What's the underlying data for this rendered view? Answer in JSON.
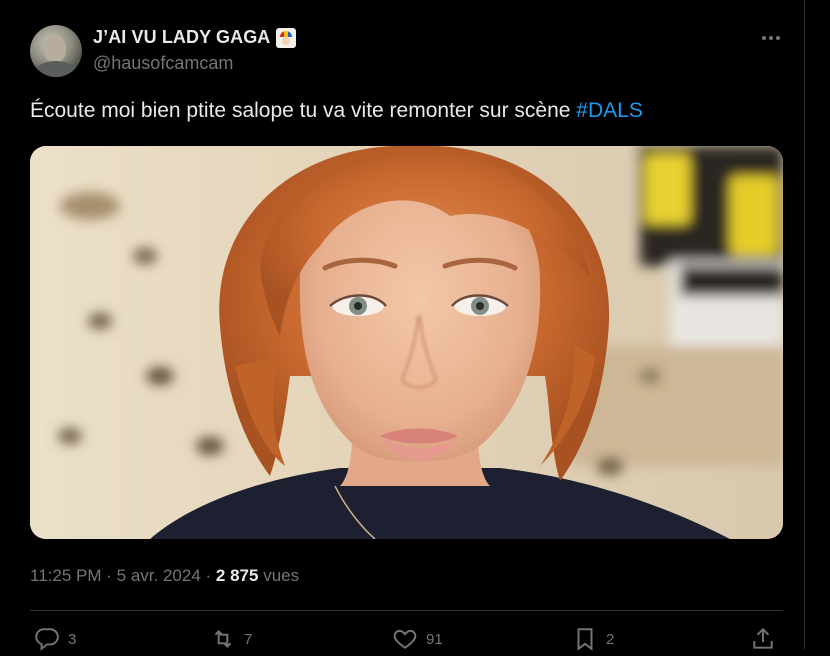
{
  "tweet": {
    "display_name": "J’AI VU LADY GAGA",
    "name_emoji_icon": "joker-card-icon",
    "handle": "@hausofcamcam",
    "text_main": "Écoute moi bien ptite salope tu va vite remonter sur scène ",
    "hashtag": "#DALS",
    "time": "11:25 PM",
    "separator": "·",
    "date": "5 avr. 2024",
    "views_count": "2 875",
    "views_label": "vues",
    "replies": "3",
    "reposts": "7",
    "likes": "91",
    "bookmarks": "2"
  },
  "colors": {
    "background": "#000000",
    "text_primary": "#e7e9ea",
    "text_secondary": "#71767b",
    "link": "#1d9bf0",
    "border": "#2f3336"
  },
  "icons": {
    "more": "more-horizontal-icon",
    "reply": "reply-bubble-icon",
    "repost": "repost-icon",
    "like": "heart-icon",
    "bookmark": "bookmark-icon",
    "share": "share-icon"
  }
}
